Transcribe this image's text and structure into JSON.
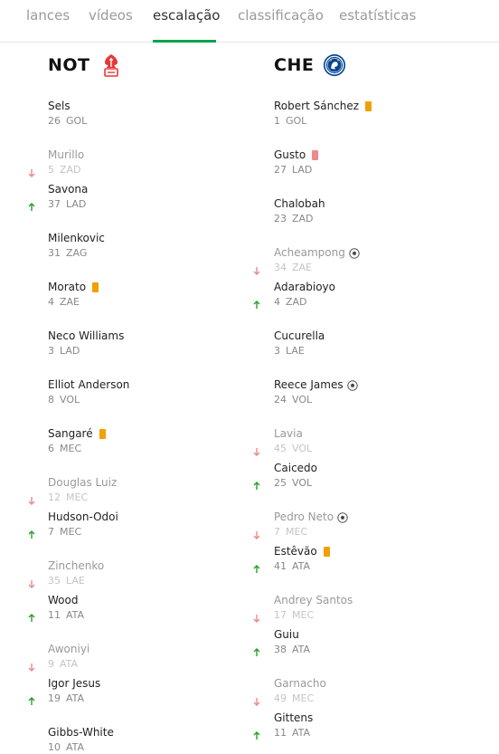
{
  "tabs": [
    {
      "label": "lances",
      "active": false
    },
    {
      "label": "vídeos",
      "active": false
    },
    {
      "label": "escalação",
      "active": true
    },
    {
      "label": "classificação",
      "active": false
    },
    {
      "label": "estatísticas",
      "active": false
    }
  ],
  "colors": {
    "accent": "#0aa34a",
    "sub_in": "#2a9d2a",
    "sub_out": "#e88a8a",
    "yellow_card": "#f0a000",
    "red_card": "#ee8a8a"
  },
  "home": {
    "abbr": "NOT",
    "crest_icon": "nottingham-forest-crest-icon",
    "players": [
      {
        "name": "Sels",
        "number": "26",
        "position": "GOL"
      },
      {
        "name": "Murillo",
        "number": "5",
        "position": "ZAD",
        "sub": "out"
      },
      {
        "name": "Savona",
        "number": "37",
        "position": "LAD",
        "sub": "in"
      },
      {
        "name": "Milenkovic",
        "number": "31",
        "position": "ZAG"
      },
      {
        "name": "Morato",
        "number": "4",
        "position": "ZAE",
        "card": "yellow"
      },
      {
        "name": "Neco Williams",
        "number": "3",
        "position": "LAD"
      },
      {
        "name": "Elliot Anderson",
        "number": "8",
        "position": "VOL"
      },
      {
        "name": "Sangaré",
        "number": "6",
        "position": "MEC",
        "card": "yellow"
      },
      {
        "name": "Douglas Luiz",
        "number": "12",
        "position": "MEC",
        "sub": "out"
      },
      {
        "name": "Hudson-Odoi",
        "number": "7",
        "position": "MEC",
        "sub": "in"
      },
      {
        "name": "Zinchenko",
        "number": "35",
        "position": "LAE",
        "sub": "out"
      },
      {
        "name": "Wood",
        "number": "11",
        "position": "ATA",
        "sub": "in"
      },
      {
        "name": "Awoniyi",
        "number": "9",
        "position": "ATA",
        "sub": "out"
      },
      {
        "name": "Igor Jesus",
        "number": "19",
        "position": "ATA",
        "sub": "in"
      },
      {
        "name": "Gibbs-White",
        "number": "10",
        "position": "ATA"
      }
    ]
  },
  "away": {
    "abbr": "CHE",
    "crest_icon": "chelsea-crest-icon",
    "players": [
      {
        "name": "Robert Sánchez",
        "number": "1",
        "position": "GOL",
        "card": "yellow"
      },
      {
        "name": "Gusto",
        "number": "27",
        "position": "LAD",
        "card": "red"
      },
      {
        "name": "Chalobah",
        "number": "23",
        "position": "ZAD"
      },
      {
        "name": "Acheampong",
        "number": "34",
        "position": "ZAE",
        "sub": "out",
        "goal": true
      },
      {
        "name": "Adarabioyo",
        "number": "4",
        "position": "ZAD",
        "sub": "in"
      },
      {
        "name": "Cucurella",
        "number": "3",
        "position": "LAE"
      },
      {
        "name": "Reece James",
        "number": "24",
        "position": "VOL",
        "goal": true
      },
      {
        "name": "Lavia",
        "number": "45",
        "position": "VOL",
        "sub": "out"
      },
      {
        "name": "Caicedo",
        "number": "25",
        "position": "VOL",
        "sub": "in"
      },
      {
        "name": "Pedro Neto",
        "number": "7",
        "position": "MEC",
        "sub": "out",
        "goal": true
      },
      {
        "name": "Estêvão",
        "number": "41",
        "position": "ATA",
        "sub": "in",
        "card": "yellow"
      },
      {
        "name": "Andrey Santos",
        "number": "17",
        "position": "MEC",
        "sub": "out"
      },
      {
        "name": "Guiu",
        "number": "38",
        "position": "ATA",
        "sub": "in"
      },
      {
        "name": "Garnacho",
        "number": "49",
        "position": "MEC",
        "sub": "out"
      },
      {
        "name": "Gittens",
        "number": "11",
        "position": "ATA",
        "sub": "in"
      }
    ]
  }
}
